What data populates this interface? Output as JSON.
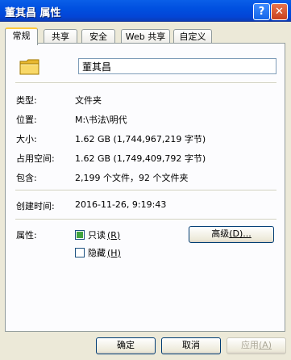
{
  "window": {
    "title": "董其昌 属性",
    "help_label": "?",
    "close_label": "✕"
  },
  "tabs": [
    {
      "label": "常规",
      "active": true
    },
    {
      "label": "共享"
    },
    {
      "label": "安全"
    },
    {
      "label": "Web 共享"
    },
    {
      "label": "自定义"
    }
  ],
  "general": {
    "icon": "folder-icon",
    "name_value": "董其昌",
    "rows": {
      "type": {
        "label": "类型:",
        "value": "文件夹"
      },
      "location": {
        "label": "位置:",
        "value": "M:\\书法\\明代"
      },
      "size": {
        "label": "大小:",
        "value": "1.62 GB (1,744,967,219 字节)"
      },
      "disk_size": {
        "label": "占用空间:",
        "value": "1.62 GB (1,749,409,792 字节)"
      },
      "contains": {
        "label": "包含:",
        "value": "2,199 个文件，92 个文件夹"
      },
      "created": {
        "label": "创建时间:",
        "value": "2016-11-26, 9:19:43"
      }
    },
    "attributes_label": "属性:",
    "readonly_label": "只读",
    "readonly_key": "(R)",
    "hidden_label": "隐藏",
    "hidden_key": "(H)",
    "advanced_label": "高级",
    "advanced_key": "(D)...",
    "readonly_state": "indeterminate",
    "hidden_state": "unchecked"
  },
  "buttons": {
    "ok": "确定",
    "cancel": "取消",
    "apply": "应用",
    "apply_key": "(A)"
  },
  "colors": {
    "titlebar": "#0050e0",
    "dialog_bg": "#ece9d8",
    "tab_highlight": "#ffc83c"
  }
}
